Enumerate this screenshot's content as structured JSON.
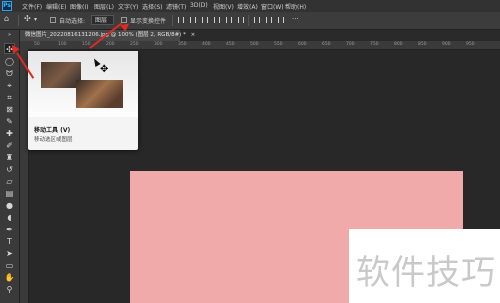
{
  "menubar": {
    "logo": "Ps",
    "items": [
      "文件(F)",
      "编辑(E)",
      "图像(I)",
      "图层(L)",
      "文字(Y)",
      "选择(S)",
      "滤镜(T)",
      "3D(D)",
      "视图(V)",
      "增效(A)",
      "窗口(W)",
      "帮助(H)"
    ]
  },
  "options": {
    "auto_select_label": "自动选择:",
    "layer_dropdown": "图层",
    "transform_label": "显示变换控件",
    "more": "···"
  },
  "document": {
    "tab_title": "微信图片_20220816131206.jpg @ 100% (图层 2, RGB/8#) *",
    "close": "×"
  },
  "ruler": {
    "marks": [
      "50",
      "100",
      "150",
      "200",
      "250",
      "300",
      "350",
      "400",
      "450",
      "500",
      "550",
      "600",
      "650",
      "700",
      "750",
      "800",
      "850",
      "900",
      "950"
    ]
  },
  "tooltip": {
    "title": "移动工具 (V)",
    "description": "移动选区或图层"
  },
  "watermark": {
    "text": "软件技巧"
  },
  "colors": {
    "canvas": "#f0aaaa",
    "annotation": "#e02a22",
    "ps_blue": "#31a8ff"
  }
}
